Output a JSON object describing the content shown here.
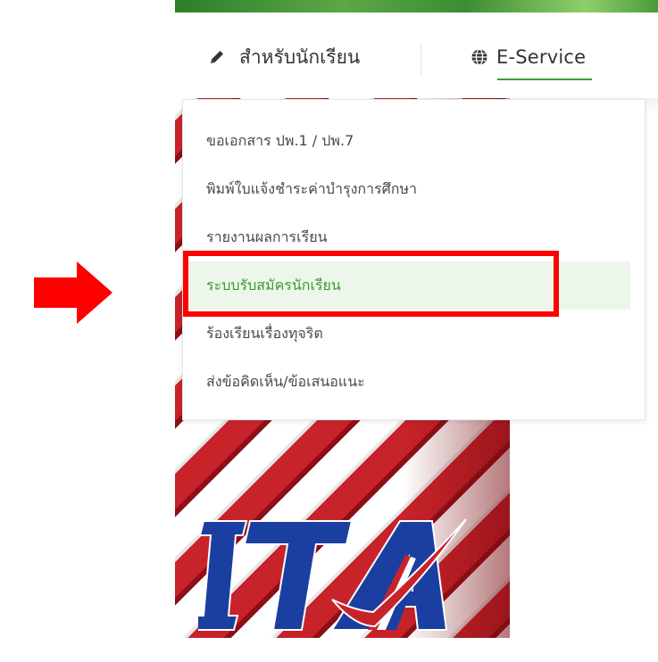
{
  "nav": {
    "student_label": "สำหรับนักเรียน",
    "eservice_label": "E-Service",
    "student_icon": "pencil-icon",
    "eservice_icon": "globe-icon",
    "accent_color": "#3ea035"
  },
  "dropdown": {
    "items": [
      {
        "label": "ขอเอกสาร ปพ.1 / ปพ.7"
      },
      {
        "label": "พิมพ์ใบแจ้งชำระค่าบำรุงการศึกษา"
      },
      {
        "label": "รายงานผลการเรียน"
      },
      {
        "label": "ระบบรับสมัครนักเรียน",
        "active": true
      },
      {
        "label": "ร้องเรียนเรื่องทุจริต"
      },
      {
        "label": "ส่งข้อคิดเห็น/ข้อเสนอแนะ"
      }
    ]
  },
  "annotation": {
    "highlight_color": "#ff0000",
    "arrow_icon": "right-arrow-icon"
  },
  "logo": {
    "text": "ITA",
    "logo_icon": "ita-logo-icon"
  }
}
